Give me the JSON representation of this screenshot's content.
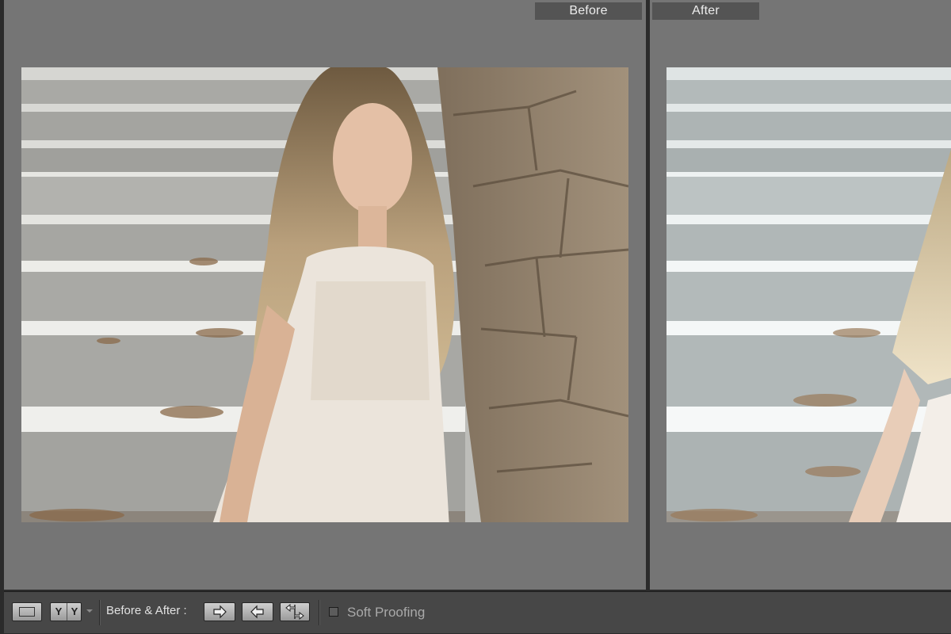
{
  "panes": {
    "before": {
      "label": "Before"
    },
    "after": {
      "label": "After"
    }
  },
  "toolbar": {
    "view_mode_yy": {
      "left": "Y",
      "right": "Y"
    },
    "before_after_label": "Before & After :",
    "soft_proofing_label": "Soft Proofing",
    "soft_proofing_checked": false
  },
  "icons": {
    "loupe_view": "rectangle-icon",
    "yy_view": "yy-icon",
    "dropdown": "chevron-down-icon",
    "copy_before_to_after": "arrow-right-icon",
    "copy_after_to_before": "arrow-left-icon",
    "swap": "swap-icon"
  },
  "colors": {
    "pane_bg": "#757575",
    "toolbar_bg": "#474747",
    "label_bg": "#545454"
  }
}
